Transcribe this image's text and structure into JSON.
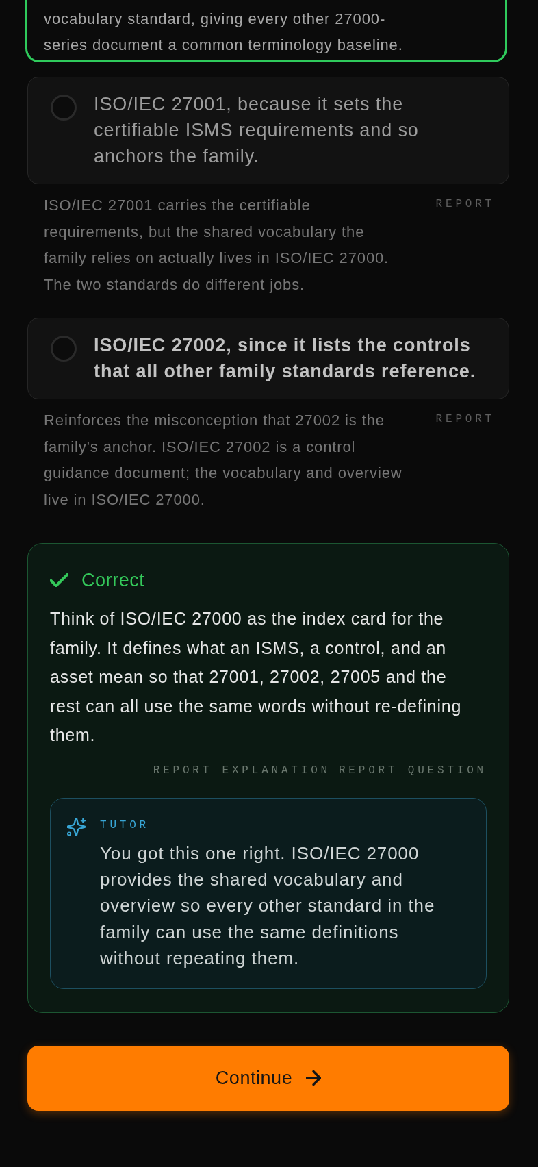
{
  "options": [
    {
      "selected": true,
      "dimmed": false,
      "explanation": "vocabulary standard, giving every other 27000-series document a common terminology baseline."
    },
    {
      "selected": false,
      "dimmed": true,
      "text": "ISO/IEC 27001, because it sets the certifiable ISMS requirements and so anchors the family.",
      "explanation": "ISO/IEC 27001 carries the certifiable requirements, but the shared vocabulary the family relies on actually lives in ISO/IEC 27000. The two standards do different jobs.",
      "report": "REPORT"
    },
    {
      "selected": false,
      "dimmed": false,
      "text": "ISO/IEC 27002, since it lists the controls that all other family standards reference.",
      "explanation": "Reinforces the misconception that 27002 is the family's anchor. ISO/IEC 27002 is a control guidance document; the vocabulary and overview live in ISO/IEC 27000.",
      "report": "REPORT"
    }
  ],
  "feedback": {
    "kind": "correct",
    "title": "Correct",
    "body": "Think of ISO/IEC 27000 as the index card for the family. It defines what an ISMS, a control, and an asset mean so that 27001, 27002, 27005 and the rest can all use the same words without re-defining them.",
    "actions": [
      "REPORT EXPLANATION",
      "REPORT QUESTION"
    ],
    "tutor": {
      "label": "TUTOR",
      "text": "You got this one right. ISO/IEC 27000 provides the shared vocabulary and overview so every other standard in the family can use the same definitions without repeating them."
    }
  },
  "continue_button": {
    "label": "Continue"
  }
}
